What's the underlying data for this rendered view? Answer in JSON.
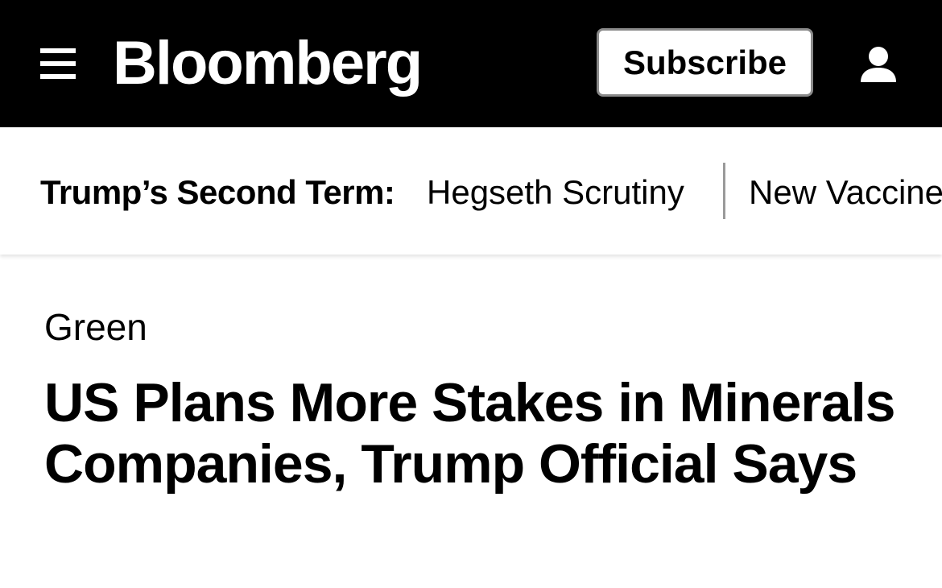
{
  "header": {
    "menu_icon": "hamburger-menu-icon",
    "logo_text": "Bloomberg",
    "subscribe_label": "Subscribe",
    "account_icon": "user-account-icon",
    "background_color": "#000000"
  },
  "trending": {
    "label": "Trump’s Second Term:",
    "items": [
      {
        "label": "Hegseth Scrutiny"
      },
      {
        "label": "New Vaccine"
      }
    ]
  },
  "article": {
    "section": "Green",
    "headline": "US Plans More Stakes in Minerals Companies, Trump Official Says"
  }
}
